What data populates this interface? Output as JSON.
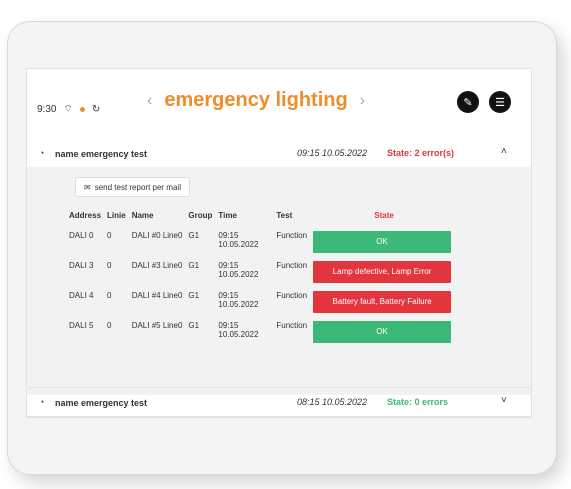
{
  "status_bar": {
    "time": "9:30"
  },
  "header": {
    "title": "emergency lighting",
    "prev": "‹",
    "next": "›"
  },
  "tests": [
    {
      "label": "name emergency test",
      "time": "09:15  10.05.2022",
      "state": "State: 2 error(s)",
      "chevron": "˄"
    },
    {
      "label": "name emergency test",
      "time": "08:15 10.05.2022",
      "state": "State: 0 errors",
      "chevron": "˅"
    }
  ],
  "mail_button": {
    "label": "send test report per mail"
  },
  "table": {
    "headers": [
      "Address",
      "Linie",
      "Name",
      "Group",
      "Time",
      "Test",
      "State"
    ],
    "rows": [
      {
        "address": "DALI 0",
        "linie": "0",
        "name": "DALI #0 Line0",
        "group": "G1",
        "time": "09:15 10.05.2022",
        "test": "Function",
        "state": "OK"
      },
      {
        "address": "DALI 3",
        "linie": "0",
        "name": "DALI #3 Line0",
        "group": "G1",
        "time": "09:15 10.05.2022",
        "test": "Function",
        "state": "Lamp defective, Lamp Error"
      },
      {
        "address": "DALI 4",
        "linie": "0",
        "name": "DALI #4 Line0",
        "group": "G1",
        "time": "09:15 10.05.2022",
        "test": "Function",
        "state": "Battery fault, Battery Failure"
      },
      {
        "address": "DALI 5",
        "linie": "0",
        "name": "DALI #5 Line0",
        "group": "G1",
        "time": "09:15 10.05.2022",
        "test": "Function",
        "state": "OK"
      }
    ]
  },
  "colors": {
    "accent": "#f28c28",
    "ok": "#3cb978",
    "error": "#e2353d"
  }
}
